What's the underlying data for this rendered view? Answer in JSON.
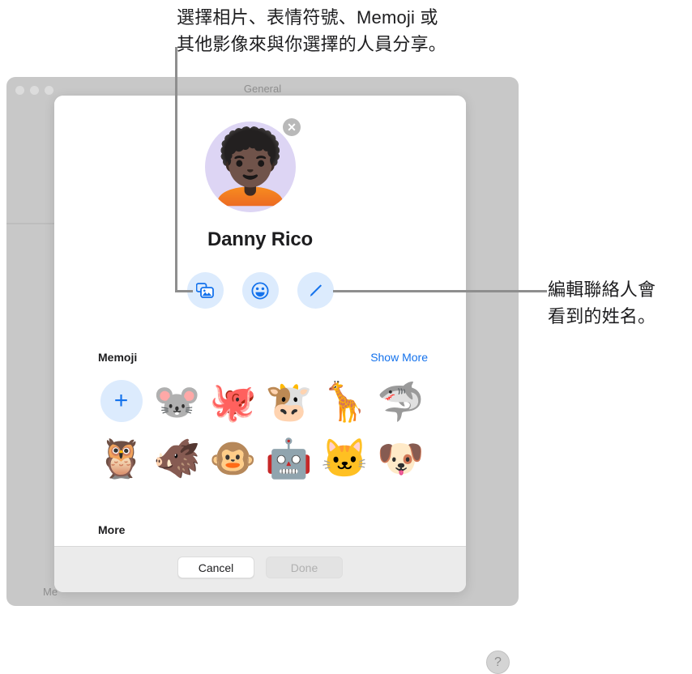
{
  "callouts": {
    "top": "選擇相片、表情符號、Memoji 或\n其他影像來與你選擇的人員分享。",
    "right": "編輯聯絡人會\n看到的姓名。"
  },
  "background_window": {
    "title": "General",
    "partial_label": "Me",
    "help_button": "?"
  },
  "sheet": {
    "avatar": {
      "memoji_glyph": "🧑🏿‍🦱",
      "remove_label": "✕"
    },
    "contact_name": "Danny Rico",
    "action_buttons": [
      {
        "name": "photos-button",
        "label": "photos-icon"
      },
      {
        "name": "emoji-button",
        "label": "emoji-icon"
      },
      {
        "name": "edit-name-button",
        "label": "pencil-icon"
      }
    ],
    "memoji_section": {
      "header": "Memoji",
      "show_more": "Show More",
      "add_label": "+",
      "items": [
        {
          "glyph": "🐭",
          "name": "mouse"
        },
        {
          "glyph": "🐙",
          "name": "octopus"
        },
        {
          "glyph": "🐮",
          "name": "cow"
        },
        {
          "glyph": "🦒",
          "name": "giraffe"
        },
        {
          "glyph": "🦈",
          "name": "shark"
        },
        {
          "glyph": "🦉",
          "name": "owl"
        },
        {
          "glyph": "🐗",
          "name": "boar"
        },
        {
          "glyph": "🐵",
          "name": "monkey"
        },
        {
          "glyph": "🤖",
          "name": "robot"
        },
        {
          "glyph": "🐱",
          "name": "cat"
        },
        {
          "glyph": "🐶",
          "name": "dog"
        }
      ]
    },
    "more_section": {
      "header": "More"
    },
    "footer": {
      "cancel": "Cancel",
      "done": "Done"
    }
  },
  "colors": {
    "accent_blue": "#1472ec",
    "action_button_bg": "#dcebfd",
    "avatar_bg": "#ddd5f4",
    "window_chrome": "#c8c8c8",
    "footer_bg": "#ebebeb",
    "leader_line": "#8e8e8e"
  }
}
